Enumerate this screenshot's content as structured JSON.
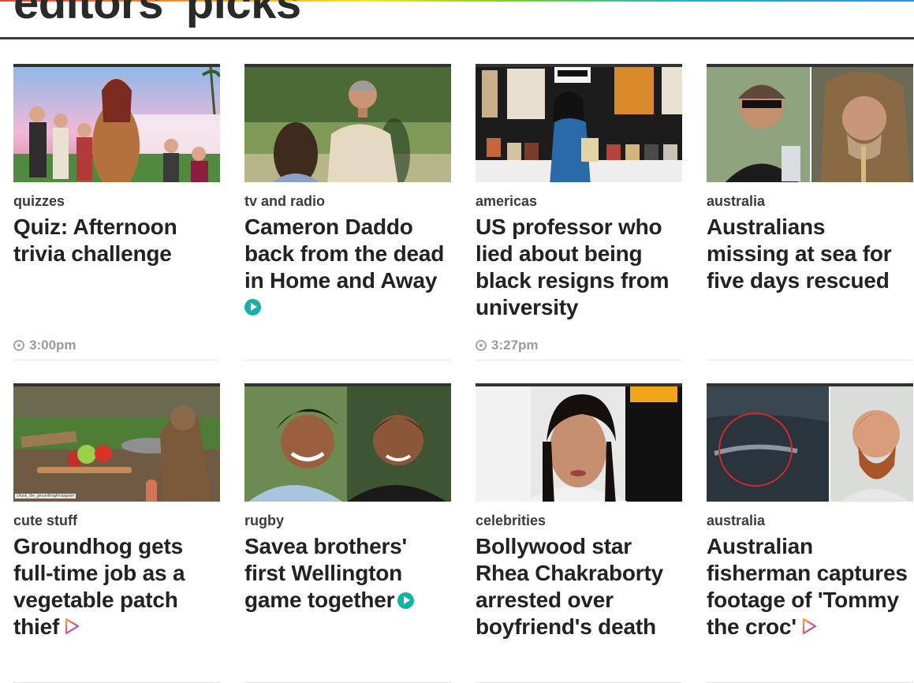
{
  "section": {
    "title": "editors' picks"
  },
  "cards": [
    {
      "category": "quizzes",
      "headline": "Quiz: Afternoon trivia challenge",
      "time": "3:00pm",
      "image": "quiz-reality-cast-image"
    },
    {
      "category": "tv and radio",
      "headline": "Cameron Daddo back from the dead in Home and Away",
      "image": "cameron-daddo-image",
      "video": "solid"
    },
    {
      "category": "americas",
      "headline": "US professor who lied about being black resigns from university",
      "time": "3:27pm",
      "image": "professor-bookstand-image"
    },
    {
      "category": "australia",
      "headline": "Australians missing at sea for five days rescued",
      "image": "missing-men-image"
    },
    {
      "category": "cute stuff",
      "headline": "Groundhog gets full-time job as a vegetable patch thief",
      "image": "groundhog-image",
      "video": "outline",
      "credit": "chunk_the_groundhog/Instagram"
    },
    {
      "category": "rugby",
      "headline": "Savea brothers' first Wellington game together",
      "image": "savea-brothers-image",
      "video": "solid"
    },
    {
      "category": "celebrities",
      "headline": "Bollywood star Rhea Chakraborty arrested over boyfriend's death",
      "image": "rhea-chakraborty-image"
    },
    {
      "category": "australia",
      "headline": "Australian fisherman captures footage of 'Tommy the croc'",
      "image": "croc-fisherman-image",
      "video": "outline"
    }
  ],
  "colors": {
    "accent": "#12b3a6",
    "text": "#222222",
    "muted": "#9a9a9a",
    "rule": "#3a3a3a"
  }
}
